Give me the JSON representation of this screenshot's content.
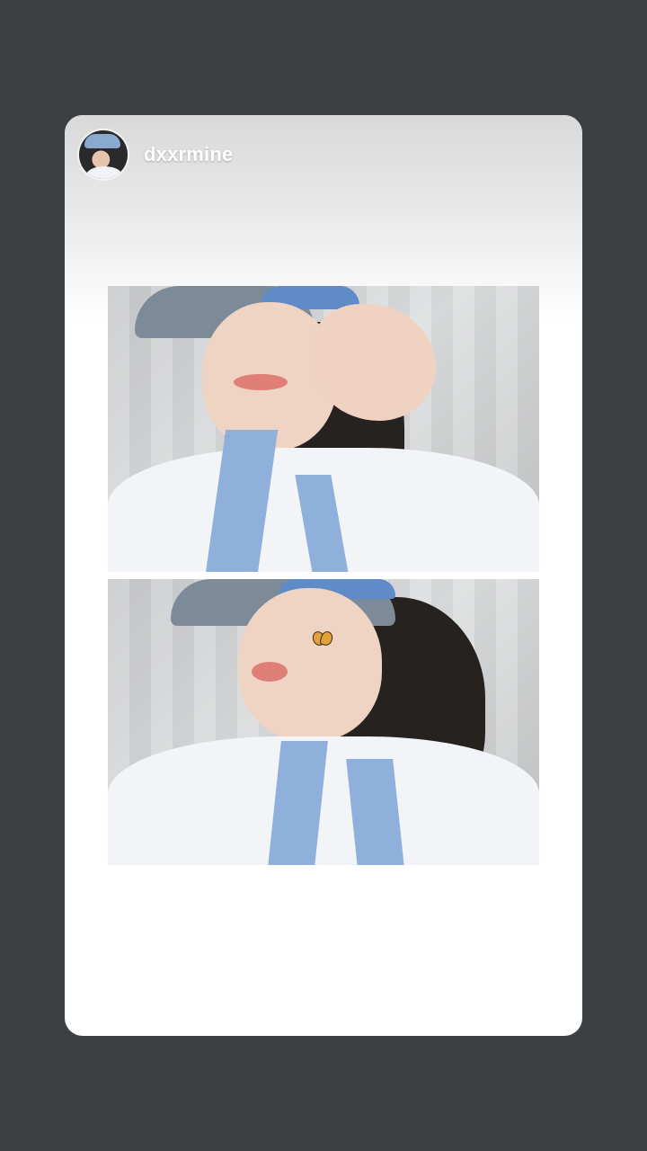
{
  "story": {
    "username": "dxxrmine",
    "photos": [
      {
        "icon": "selfie-photo-1"
      },
      {
        "icon": "selfie-photo-2"
      }
    ]
  },
  "colors": {
    "background": "#3c4043",
    "card": "#ffffff",
    "gradient_top": "#d9d9d9"
  }
}
